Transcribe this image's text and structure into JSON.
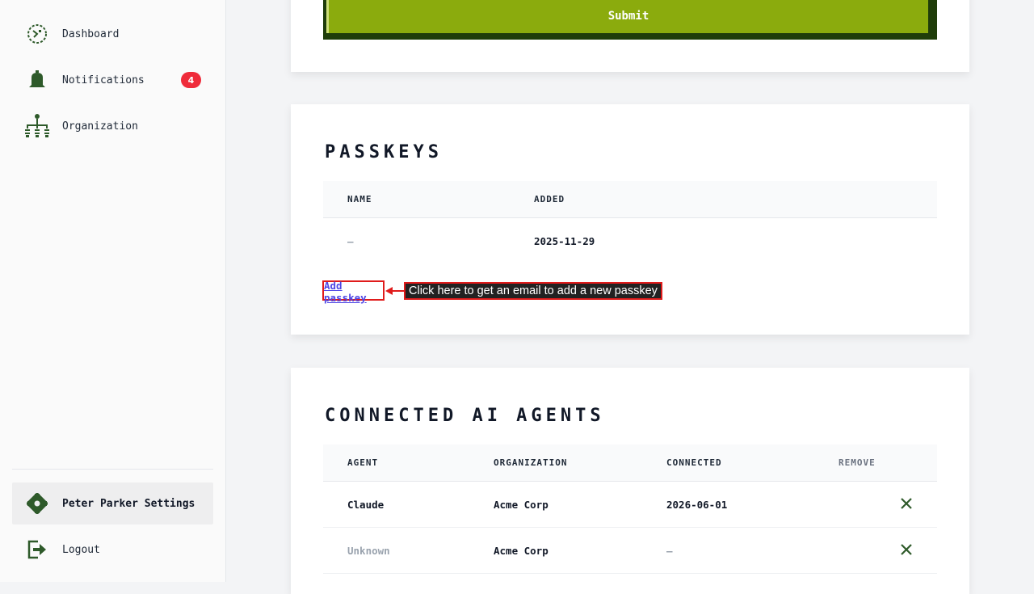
{
  "sidebar": {
    "items": [
      {
        "label": "Dashboard",
        "icon": "dashboard-icon"
      },
      {
        "label": "Notifications",
        "icon": "bell-icon",
        "badge": "4"
      },
      {
        "label": "Organization",
        "icon": "org-chart-icon"
      }
    ],
    "footer": [
      {
        "label": "Peter Parker Settings",
        "icon": "gear-icon",
        "active": true
      },
      {
        "label": "Logout",
        "icon": "logout-icon"
      }
    ]
  },
  "form": {
    "submit_label": "Submit"
  },
  "passkeys": {
    "title": "PASSKEYS",
    "headers": [
      "NAME",
      "ADDED"
    ],
    "rows": [
      {
        "name": "–",
        "added": "2025-11-29"
      }
    ],
    "add_label": "Add passkey",
    "annotation": "Click here to get an email to add a new passkey"
  },
  "agents": {
    "title": "CONNECTED AI AGENTS",
    "headers": [
      "AGENT",
      "ORGANIZATION",
      "CONNECTED",
      "REMOVE"
    ],
    "rows": [
      {
        "agent": "Claude",
        "organization": "Acme Corp",
        "connected": "2026-06-01"
      },
      {
        "agent": "Unknown",
        "organization": "Acme Corp",
        "connected": "–"
      }
    ]
  },
  "colors": {
    "accent_green": "#8bab0d",
    "dark_green": "#1f3d0a",
    "icon_green": "#2e5a2a",
    "badge_red": "#ef2b3a",
    "link_blue": "#4f46e5",
    "annotation_red": "#e01b1b"
  }
}
